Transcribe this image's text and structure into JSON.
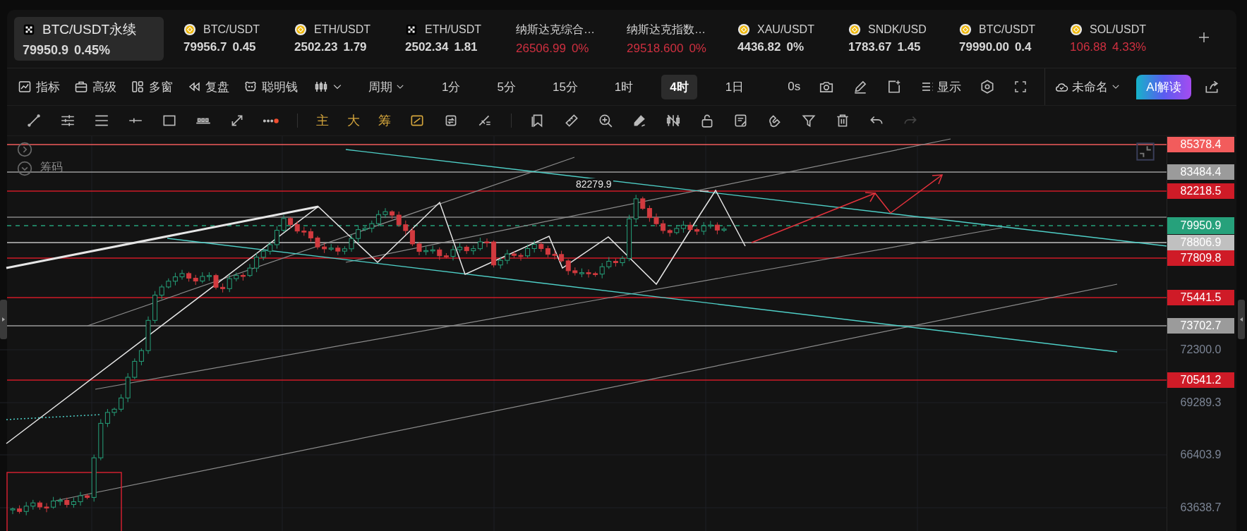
{
  "tickers": [
    {
      "symbol": "BTC/USDT永续",
      "price": "79950.9",
      "change": "0.45%",
      "selected": true,
      "kind": "perp",
      "falling": false
    },
    {
      "symbol": "BTC/USDT",
      "price": "79956.7",
      "change": "0.45",
      "selected": false,
      "kind": "coin",
      "falling": false
    },
    {
      "symbol": "ETH/USDT",
      "price": "2502.23",
      "change": "1.79",
      "selected": false,
      "kind": "coin",
      "falling": false
    },
    {
      "symbol": "ETH/USDT",
      "price": "2502.34",
      "change": "1.81",
      "selected": false,
      "kind": "perp",
      "falling": false
    },
    {
      "symbol": "纳斯达克综合…",
      "price": "26506.99",
      "change": "0%",
      "selected": false,
      "kind": "index",
      "falling": true
    },
    {
      "symbol": "纳斯达克指数…",
      "price": "29518.600",
      "change": "0%",
      "selected": false,
      "kind": "index",
      "falling": true
    },
    {
      "symbol": "XAU/USDT",
      "price": "4436.82",
      "change": "0%",
      "selected": false,
      "kind": "coin",
      "falling": false
    },
    {
      "symbol": "SNDK/USD",
      "price": "1783.67",
      "change": "1.45",
      "selected": false,
      "kind": "coin",
      "falling": false
    },
    {
      "symbol": "BTC/USDT",
      "price": "79990.00",
      "change": "0.4",
      "selected": false,
      "kind": "coin",
      "falling": false
    },
    {
      "symbol": "SOL/USDT",
      "price": "106.88",
      "change": "4.33%",
      "selected": false,
      "kind": "coin",
      "falling": true
    }
  ],
  "toolbar": {
    "menus": [
      "指标",
      "高级",
      "多窗",
      "复盘",
      "聪明钱"
    ],
    "period_label": "周期",
    "intervals": [
      {
        "label": "1分",
        "selected": false
      },
      {
        "label": "5分",
        "selected": false
      },
      {
        "label": "15分",
        "selected": false
      },
      {
        "label": "1时",
        "selected": false
      },
      {
        "label": "4时",
        "selected": true
      },
      {
        "label": "1日",
        "selected": false
      }
    ],
    "countdown": "0s",
    "display_label": "显示",
    "layout_name": "未命名",
    "ai_button": "AI解读"
  },
  "drawing_tools": {
    "indicator_shortcuts": [
      "主",
      "大",
      "筹"
    ]
  },
  "chart": {
    "overlay_label": "筹码",
    "peak_label": "82279.9",
    "price_axis": [
      {
        "value": "85378.4",
        "kind": "tag",
        "color": "#f25c5c"
      },
      {
        "value": "83484.4",
        "kind": "tag",
        "color": "#9b9b9b"
      },
      {
        "value": "82218.5",
        "kind": "tag",
        "color": "#cf1b27"
      },
      {
        "value": "79950.9",
        "kind": "current",
        "color": "#26a17b"
      },
      {
        "value": "78806.9",
        "kind": "tag",
        "color": "#c0c0c0"
      },
      {
        "value": "77809.8",
        "kind": "tag",
        "color": "#cf1b27"
      },
      {
        "value": "75441.5",
        "kind": "tag",
        "color": "#cf1b27"
      },
      {
        "value": "73702.7",
        "kind": "tag",
        "color": "#9b9b9b"
      },
      {
        "value": "72300.0",
        "kind": "tick"
      },
      {
        "value": "70541.2",
        "kind": "tag",
        "color": "#cf1b27"
      },
      {
        "value": "69289.3",
        "kind": "tick"
      },
      {
        "value": "66403.9",
        "kind": "tick"
      },
      {
        "value": "63638.7",
        "kind": "tick"
      }
    ]
  }
}
